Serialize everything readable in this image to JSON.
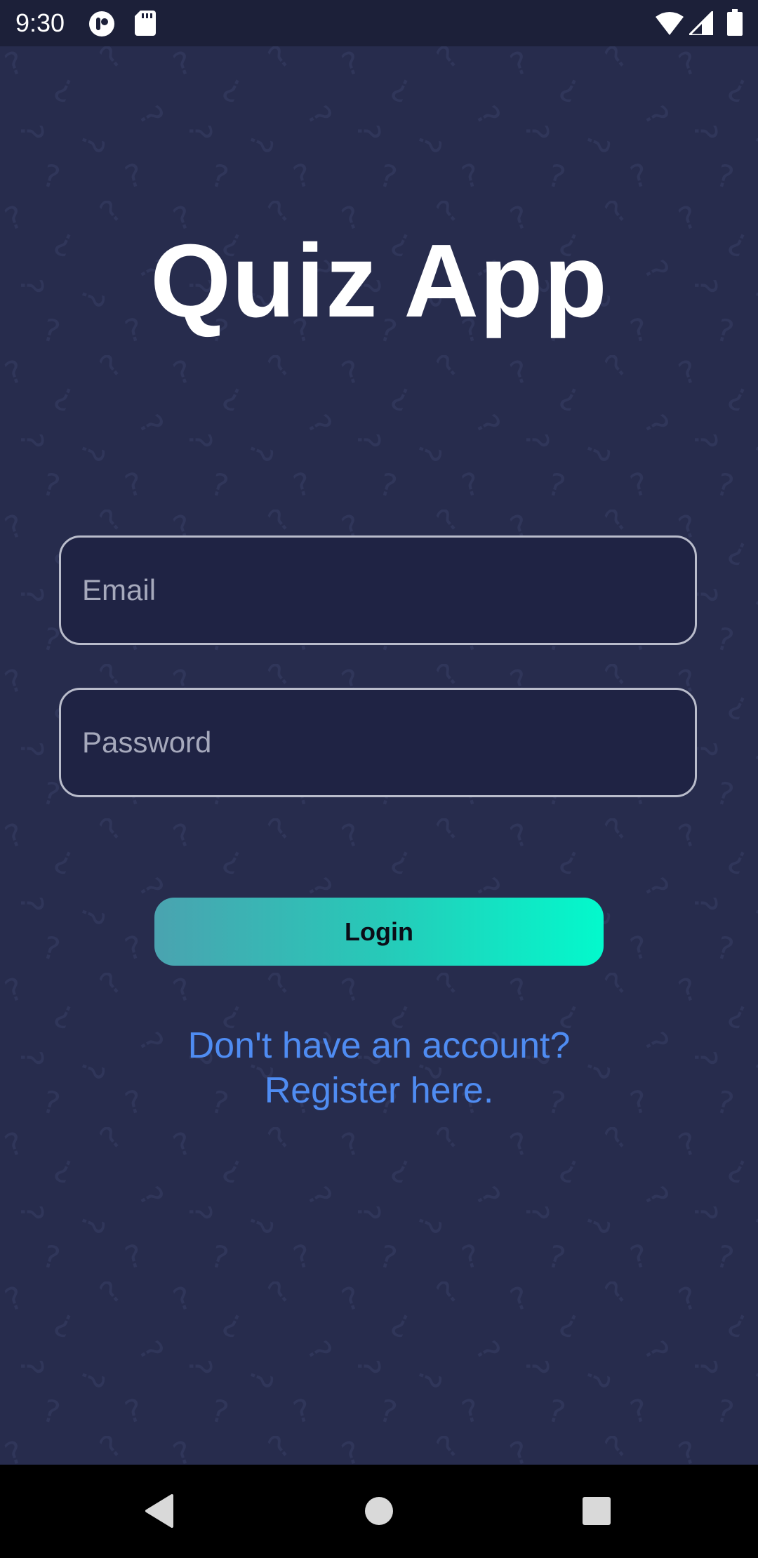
{
  "status_bar": {
    "time": "9:30",
    "icons": [
      "app-notification-icon",
      "sd-card-icon",
      "wifi-icon",
      "signal-icon",
      "battery-icon"
    ]
  },
  "app": {
    "title": "Quiz App",
    "email_placeholder": "Email",
    "password_placeholder": "Password",
    "login_label": "Login",
    "register_line1": "Don't have an account?",
    "register_line2": "Register here."
  },
  "nav_bar": {
    "icons": [
      "back-icon",
      "home-icon",
      "recents-icon"
    ]
  },
  "colors": {
    "background": "#272c4d",
    "field_background": "#1f2344",
    "field_border": "#b9bccb",
    "button_gradient_start": "#4aa3b0",
    "button_gradient_end": "#03f9cc",
    "link": "#4f8cf2"
  }
}
